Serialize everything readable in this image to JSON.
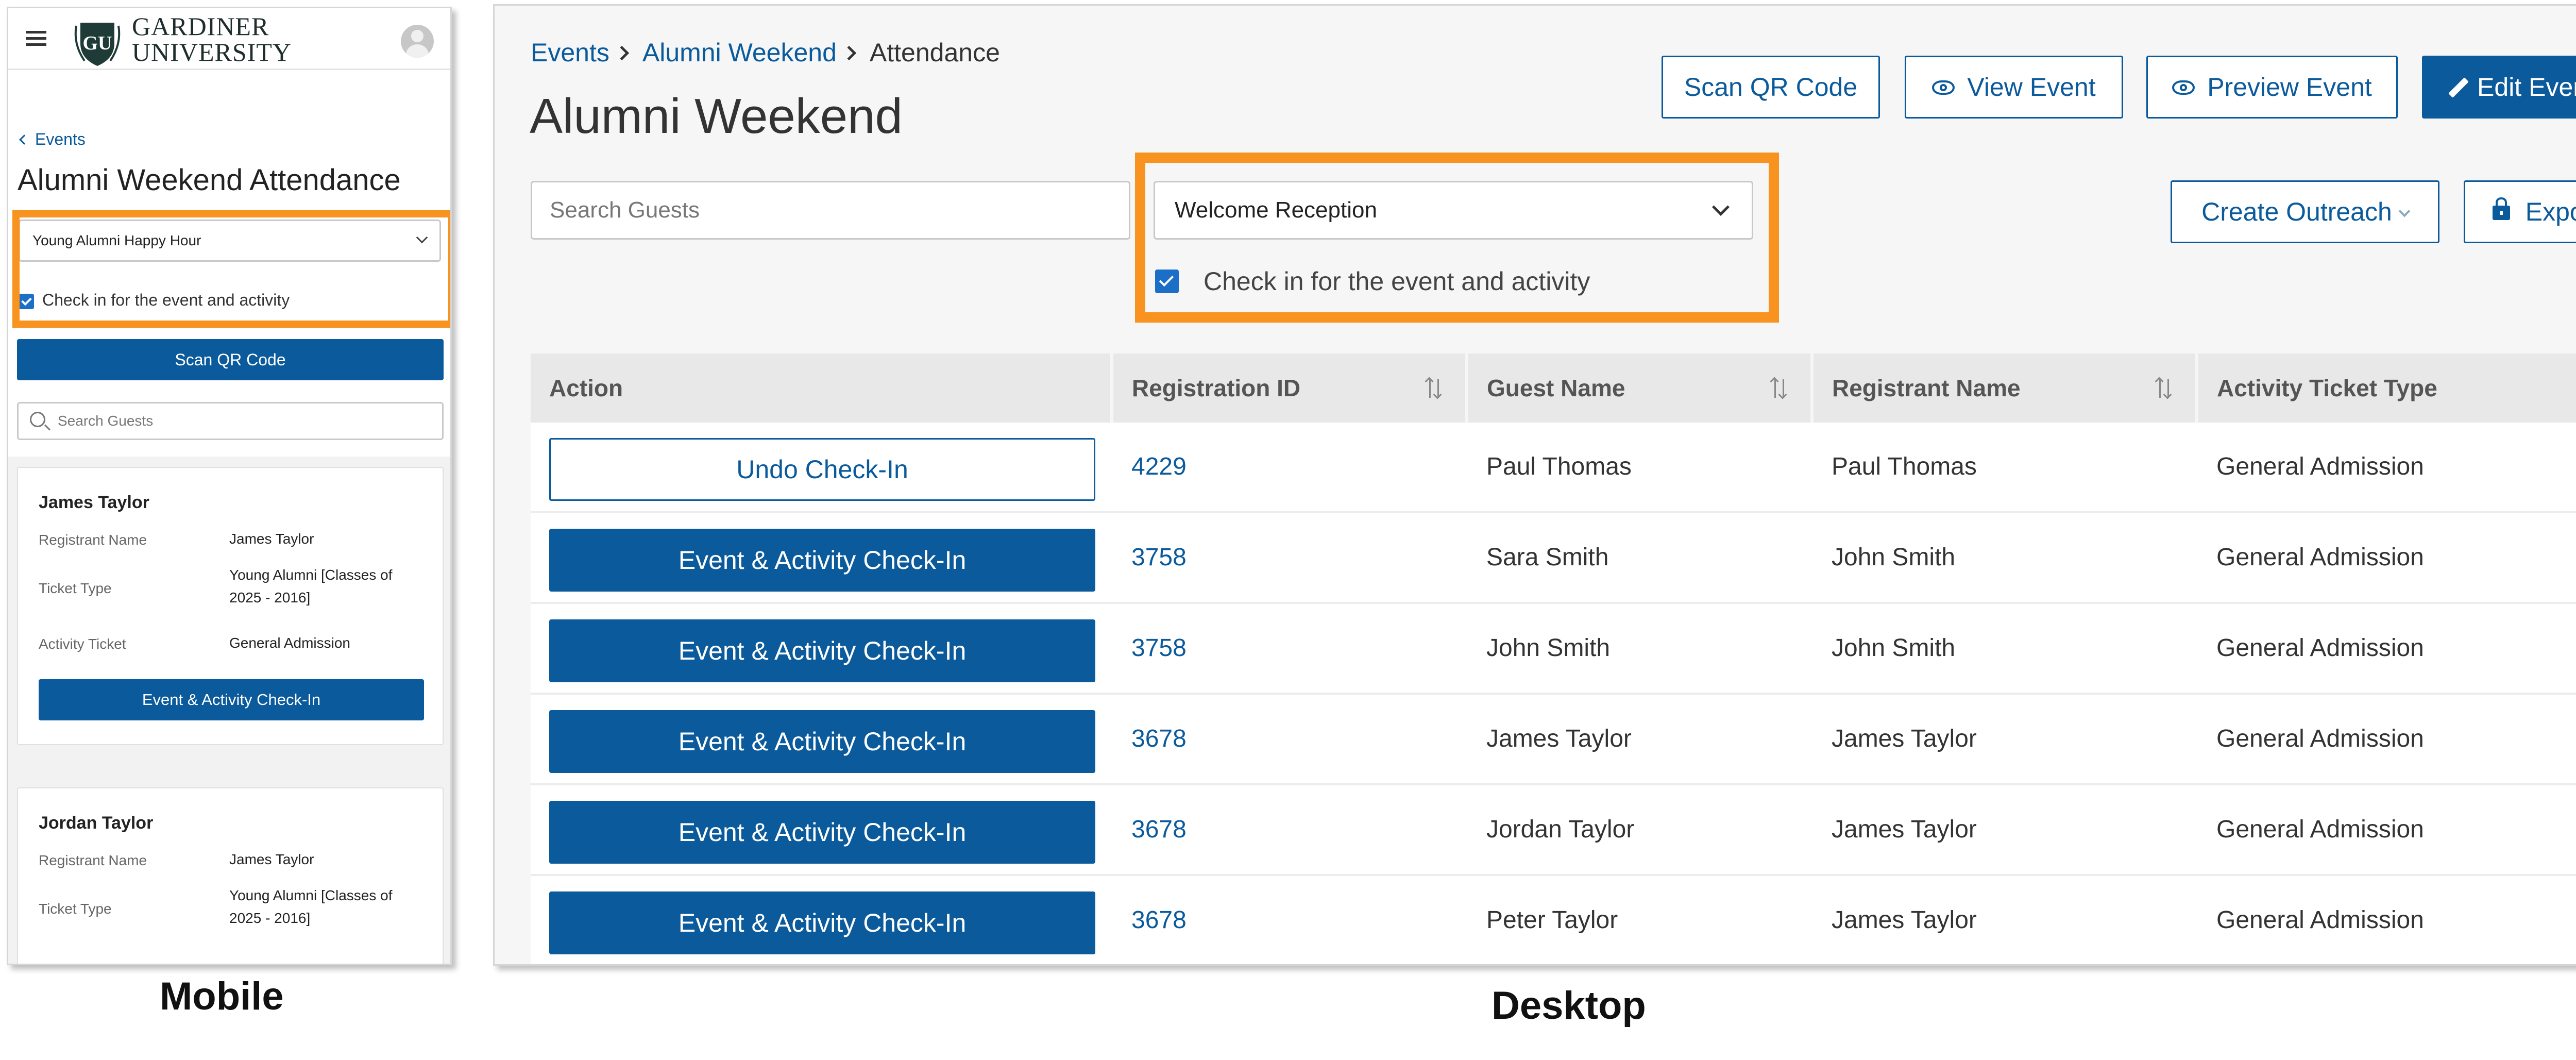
{
  "colors": {
    "primary": "#0a5a9c",
    "highlight": "#f7931e",
    "checkbox": "#1b6fc7"
  },
  "mobile": {
    "brand": {
      "line1": "GARDINER",
      "line2": "UNIVERSITY",
      "logo_text": "GU"
    },
    "back_label": "Events",
    "title": "Alumni Weekend Attendance",
    "activity_select": "Young Alumni Happy Hour",
    "checkbox_label": "Check in for the event and activity",
    "checkbox_checked": true,
    "scan_button": "Scan QR Code",
    "search_placeholder": "Search Guests",
    "labels": {
      "registrant": "Registrant Name",
      "ticket_type": "Ticket Type",
      "activity_ticket": "Activity Ticket"
    },
    "cards": [
      {
        "name": "James Taylor",
        "registrant": "James Taylor",
        "ticket_type": "Young Alumni [Classes of 2025 - 2016]",
        "activity_ticket": "General Admission",
        "button": "Event & Activity Check-In"
      },
      {
        "name": "Jordan Taylor",
        "registrant": "James Taylor",
        "ticket_type": "Young Alumni [Classes of 2025 - 2016]"
      }
    ],
    "caption": "Mobile"
  },
  "desktop": {
    "breadcrumb": [
      "Events",
      "Alumni Weekend",
      "Attendance"
    ],
    "title": "Alumni Weekend",
    "buttons": {
      "scan": "Scan QR Code",
      "view": "View Event",
      "preview": "Preview Event",
      "edit": "Edit Event",
      "outreach": "Create Outreach",
      "export": "Export"
    },
    "search_placeholder": "Search Guests",
    "activity_select": "Welcome Reception",
    "checkbox_label": "Check in for the event and activity",
    "checkbox_checked": true,
    "columns": [
      "Action",
      "Registration ID",
      "Guest Name",
      "Registrant Name",
      "Activity Ticket Type"
    ],
    "rows": [
      {
        "action": "Undo Check-In",
        "checked_in": true,
        "reg_id": "4229",
        "guest": "Paul Thomas",
        "registrant": "Paul Thomas",
        "ticket": "General Admission"
      },
      {
        "action": "Event & Activity Check-In",
        "checked_in": false,
        "reg_id": "3758",
        "guest": "Sara Smith",
        "registrant": "John Smith",
        "ticket": "General Admission"
      },
      {
        "action": "Event & Activity Check-In",
        "checked_in": false,
        "reg_id": "3758",
        "guest": "John Smith",
        "registrant": "John Smith",
        "ticket": "General Admission"
      },
      {
        "action": "Event & Activity Check-In",
        "checked_in": false,
        "reg_id": "3678",
        "guest": "James Taylor",
        "registrant": "James Taylor",
        "ticket": "General Admission"
      },
      {
        "action": "Event & Activity Check-In",
        "checked_in": false,
        "reg_id": "3678",
        "guest": "Jordan Taylor",
        "registrant": "James Taylor",
        "ticket": "General Admission"
      },
      {
        "action": "Event & Activity Check-In",
        "checked_in": false,
        "reg_id": "3678",
        "guest": "Peter Taylor",
        "registrant": "James Taylor",
        "ticket": "General Admission"
      }
    ],
    "caption": "Desktop"
  }
}
